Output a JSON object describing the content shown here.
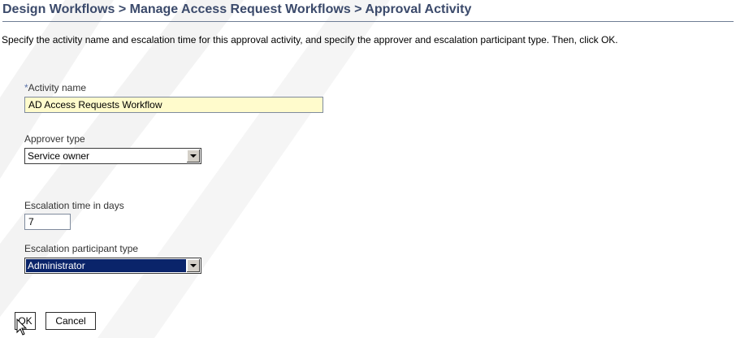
{
  "header": {
    "breadcrumb_title": "Design Workflows > Manage Access Request Workflows > Approval Activity"
  },
  "instructions": "Specify the activity name and escalation time for this approval activity, and specify the approver and escalation participant type. Then, click OK.",
  "form": {
    "activity_name": {
      "required_marker": "*",
      "label": "Activity name",
      "value": "AD Access Requests Workflow"
    },
    "approver_type": {
      "label": "Approver type",
      "selected": "Service owner"
    },
    "escalation_time": {
      "label": "Escalation time in days",
      "value": "7"
    },
    "escalation_participant_type": {
      "label": "Escalation participant type",
      "selected": "Administrator"
    }
  },
  "buttons": {
    "ok_label": "OK",
    "cancel_label": "Cancel"
  },
  "colors": {
    "title_text": "#3b4a6b",
    "required_field_bg": "#fffbcc",
    "selected_highlight": "#0a246a"
  }
}
